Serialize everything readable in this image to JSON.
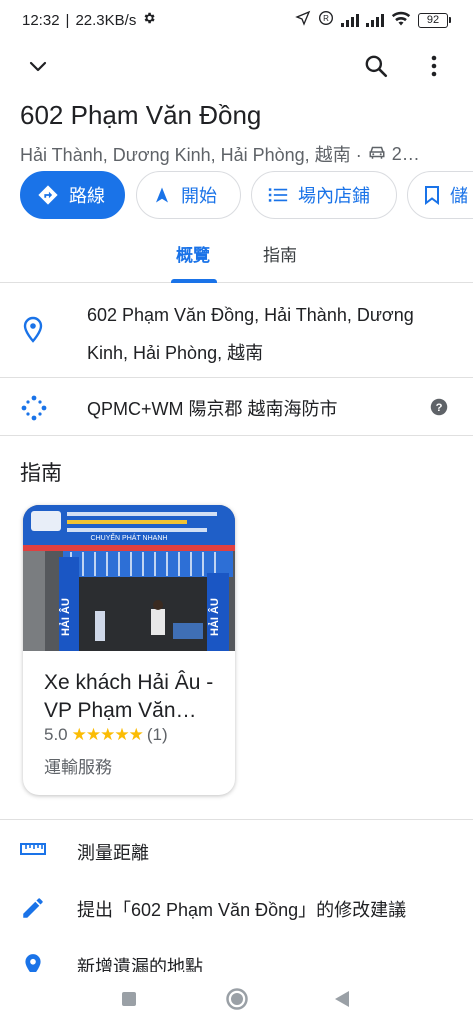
{
  "status": {
    "time": "12:32",
    "speed": "22.3KB/s",
    "battery": "92"
  },
  "place": {
    "title": "602 Phạm Văn Đồng",
    "subtitle": "Hải Thành, Dương Kinh, Hải Phòng, 越南 ·",
    "drive_time": "2…"
  },
  "chips": {
    "directions": "路線",
    "start": "開始",
    "directory": "場內店鋪",
    "save": "儲"
  },
  "tabs": {
    "overview": "概覽",
    "guide": "指南"
  },
  "info": {
    "address": "602 Phạm Văn Đồng, Hải Thành, Dương Kinh, Hải Phòng, 越南",
    "plus_code": "QPMC+WM 陽京郡 越南海防市"
  },
  "guide": {
    "heading": "指南",
    "card": {
      "title": "Xe khách Hải Âu - VP Phạm Văn…",
      "rating": "5.0",
      "stars": "★★★★★",
      "reviews": "(1)",
      "category": "運輸服務",
      "sign_text": "HẢI ÂU",
      "banner_text": "CHUYỂN PHÁT NHANH"
    }
  },
  "actions": {
    "measure": "測量距離",
    "suggest_edit": "提出「602 Phạm Văn Đồng」的修改建議",
    "add_missing": "新增遺漏的地點"
  },
  "colors": {
    "accent": "#1a73e8",
    "star": "#fbbc04"
  }
}
